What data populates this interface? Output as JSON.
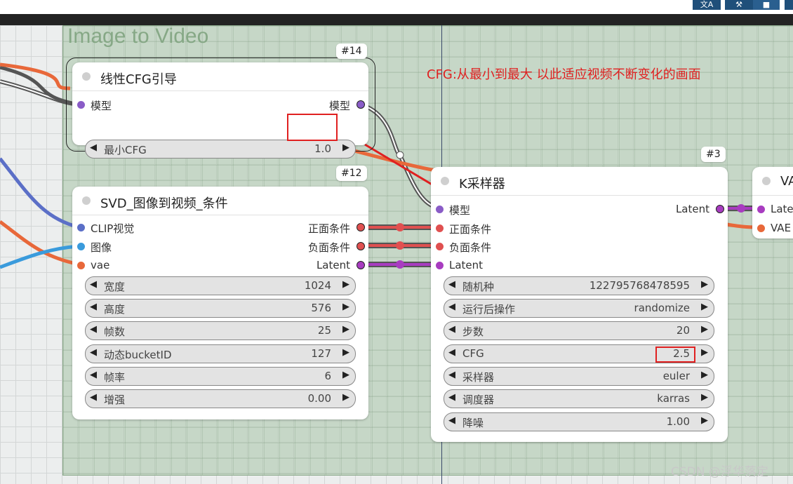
{
  "toolbar": {
    "translate_icon": "translate-icon",
    "tool_icon": "tool-icon",
    "bookmark_icon": "bookmark-icon"
  },
  "group": {
    "title": "Image to Video"
  },
  "annotation": {
    "text": "CFG:从最小到最大  以此适应视频不断变化的画面"
  },
  "node_cfg": {
    "badge": "#14",
    "title": "线性CFG引导",
    "input_label": "模型",
    "output_label": "模型",
    "widget": {
      "label": "最小CFG",
      "value": "1.0"
    }
  },
  "node_svd": {
    "badge": "#12",
    "title": "SVD_图像到视频_条件",
    "inputs": [
      "CLIP视觉",
      "图像",
      "vae"
    ],
    "outputs": [
      "正面条件",
      "负面条件",
      "Latent"
    ],
    "widgets": [
      {
        "label": "宽度",
        "value": "1024"
      },
      {
        "label": "高度",
        "value": "576"
      },
      {
        "label": "帧数",
        "value": "25"
      },
      {
        "label": "动态bucketID",
        "value": "127"
      },
      {
        "label": "帧率",
        "value": "6"
      },
      {
        "label": "增强",
        "value": "0.00"
      }
    ]
  },
  "node_ksampler": {
    "badge": "#3",
    "title": "K采样器",
    "inputs": [
      "模型",
      "正面条件",
      "负面条件",
      "Latent"
    ],
    "output": "Latent",
    "widgets": [
      {
        "label": "随机种",
        "value": "122795768478595"
      },
      {
        "label": "运行后操作",
        "value": "randomize"
      },
      {
        "label": "步数",
        "value": "20"
      },
      {
        "label": "CFG",
        "value": "2.5"
      },
      {
        "label": "采样器",
        "value": "euler"
      },
      {
        "label": "调度器",
        "value": "karras"
      },
      {
        "label": "降噪",
        "value": "1.00"
      }
    ]
  },
  "node_vae": {
    "title": "VA",
    "inputs": [
      "Late",
      "VAE"
    ]
  },
  "watermark": "CSDN @浮华落定",
  "colors": {
    "model": "#8a5cc7",
    "conditioning": "#e05050",
    "latent": "#a83cc0",
    "clip_vision": "#5b6fc7",
    "image": "#3a9bdc",
    "vae": "#e8683a",
    "annotation": "#e02020"
  }
}
